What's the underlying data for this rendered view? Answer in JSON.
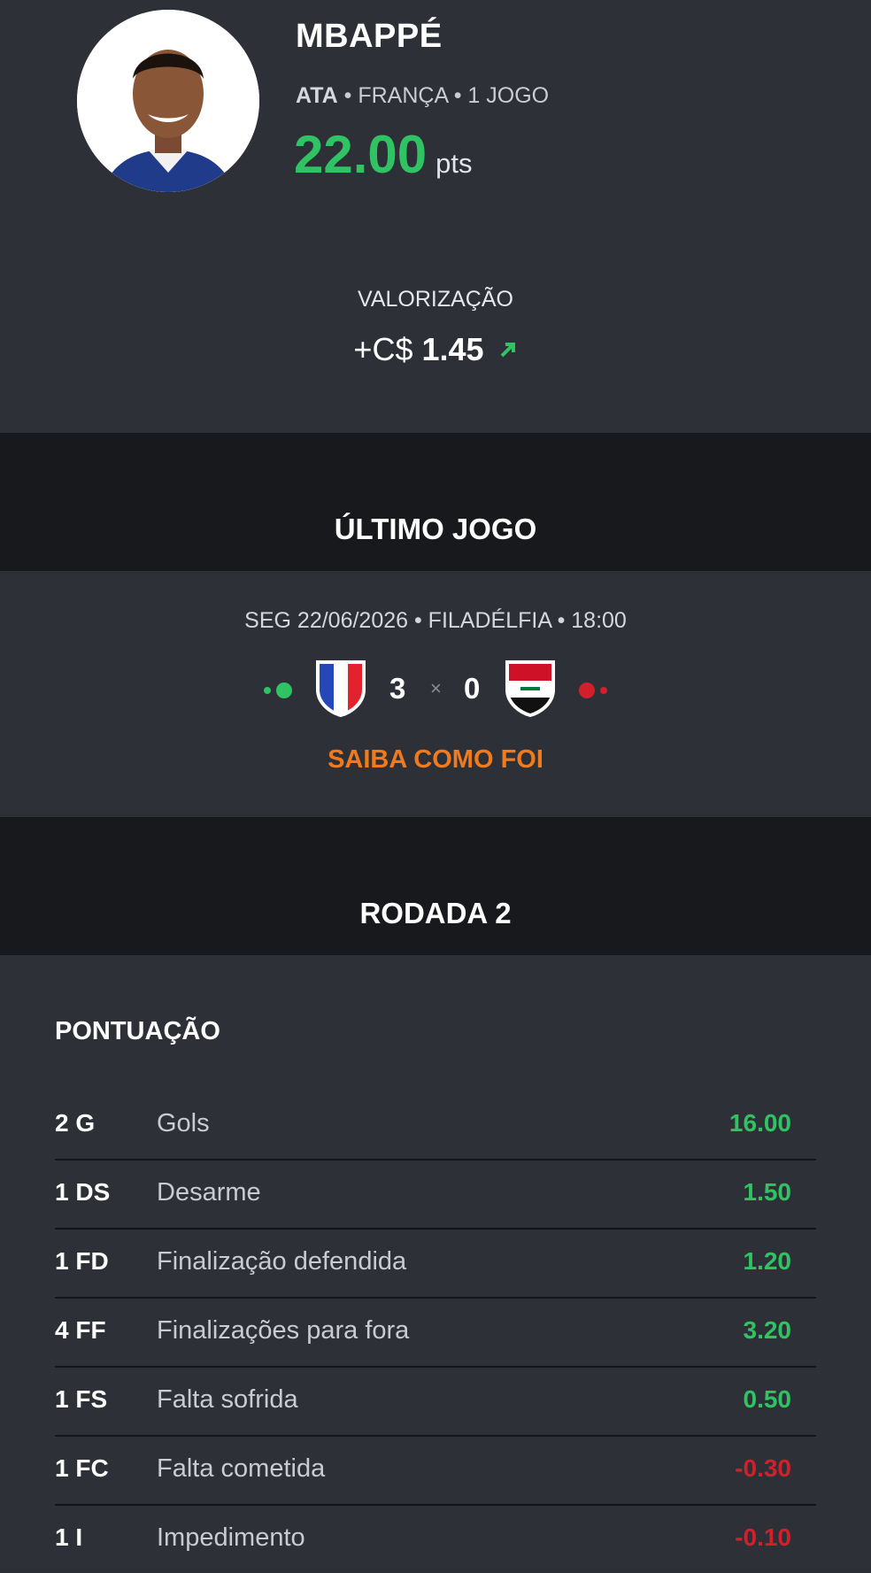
{
  "player": {
    "name": "MBAPPÉ",
    "position": "ATA",
    "country": "FRANÇA",
    "games": "1 JOGO",
    "separator": "•",
    "points": "22.00",
    "points_unit": "pts"
  },
  "valorization": {
    "label": "VALORIZAÇÃO",
    "prefix": "+C$",
    "amount": "1.45",
    "trend_icon": "arrow-up-right-icon"
  },
  "last_game": {
    "section_title": "ÚLTIMO JOGO",
    "info": "SEG 22/06/2026 • FILADÉLFIA • 18:00",
    "home_score": "3",
    "away_score": "0",
    "times": "×",
    "home_team_icon": "france-flag-icon",
    "away_team_icon": "iraq-flag-icon",
    "cta": "SAIBA COMO FOI"
  },
  "round": {
    "section_title": "RODADA 2"
  },
  "scoring": {
    "title": "PONTUAÇÃO",
    "rows": [
      {
        "code": "2 G",
        "desc": "Gols",
        "points": "16.00",
        "sign": "positive"
      },
      {
        "code": "1 DS",
        "desc": "Desarme",
        "points": "1.50",
        "sign": "positive"
      },
      {
        "code": "1 FD",
        "desc": "Finalização defendida",
        "points": "1.20",
        "sign": "positive"
      },
      {
        "code": "4 FF",
        "desc": "Finalizações para fora",
        "points": "3.20",
        "sign": "positive"
      },
      {
        "code": "1 FS",
        "desc": "Falta sofrida",
        "points": "0.50",
        "sign": "positive"
      },
      {
        "code": "1 FC",
        "desc": "Falta cometida",
        "points": "-0.30",
        "sign": "negative"
      },
      {
        "code": "1 I",
        "desc": "Impedimento",
        "points": "-0.10",
        "sign": "negative"
      }
    ]
  },
  "colors": {
    "positive": "#2fc363",
    "negative": "#d1202b",
    "accent": "#f07a1c"
  }
}
